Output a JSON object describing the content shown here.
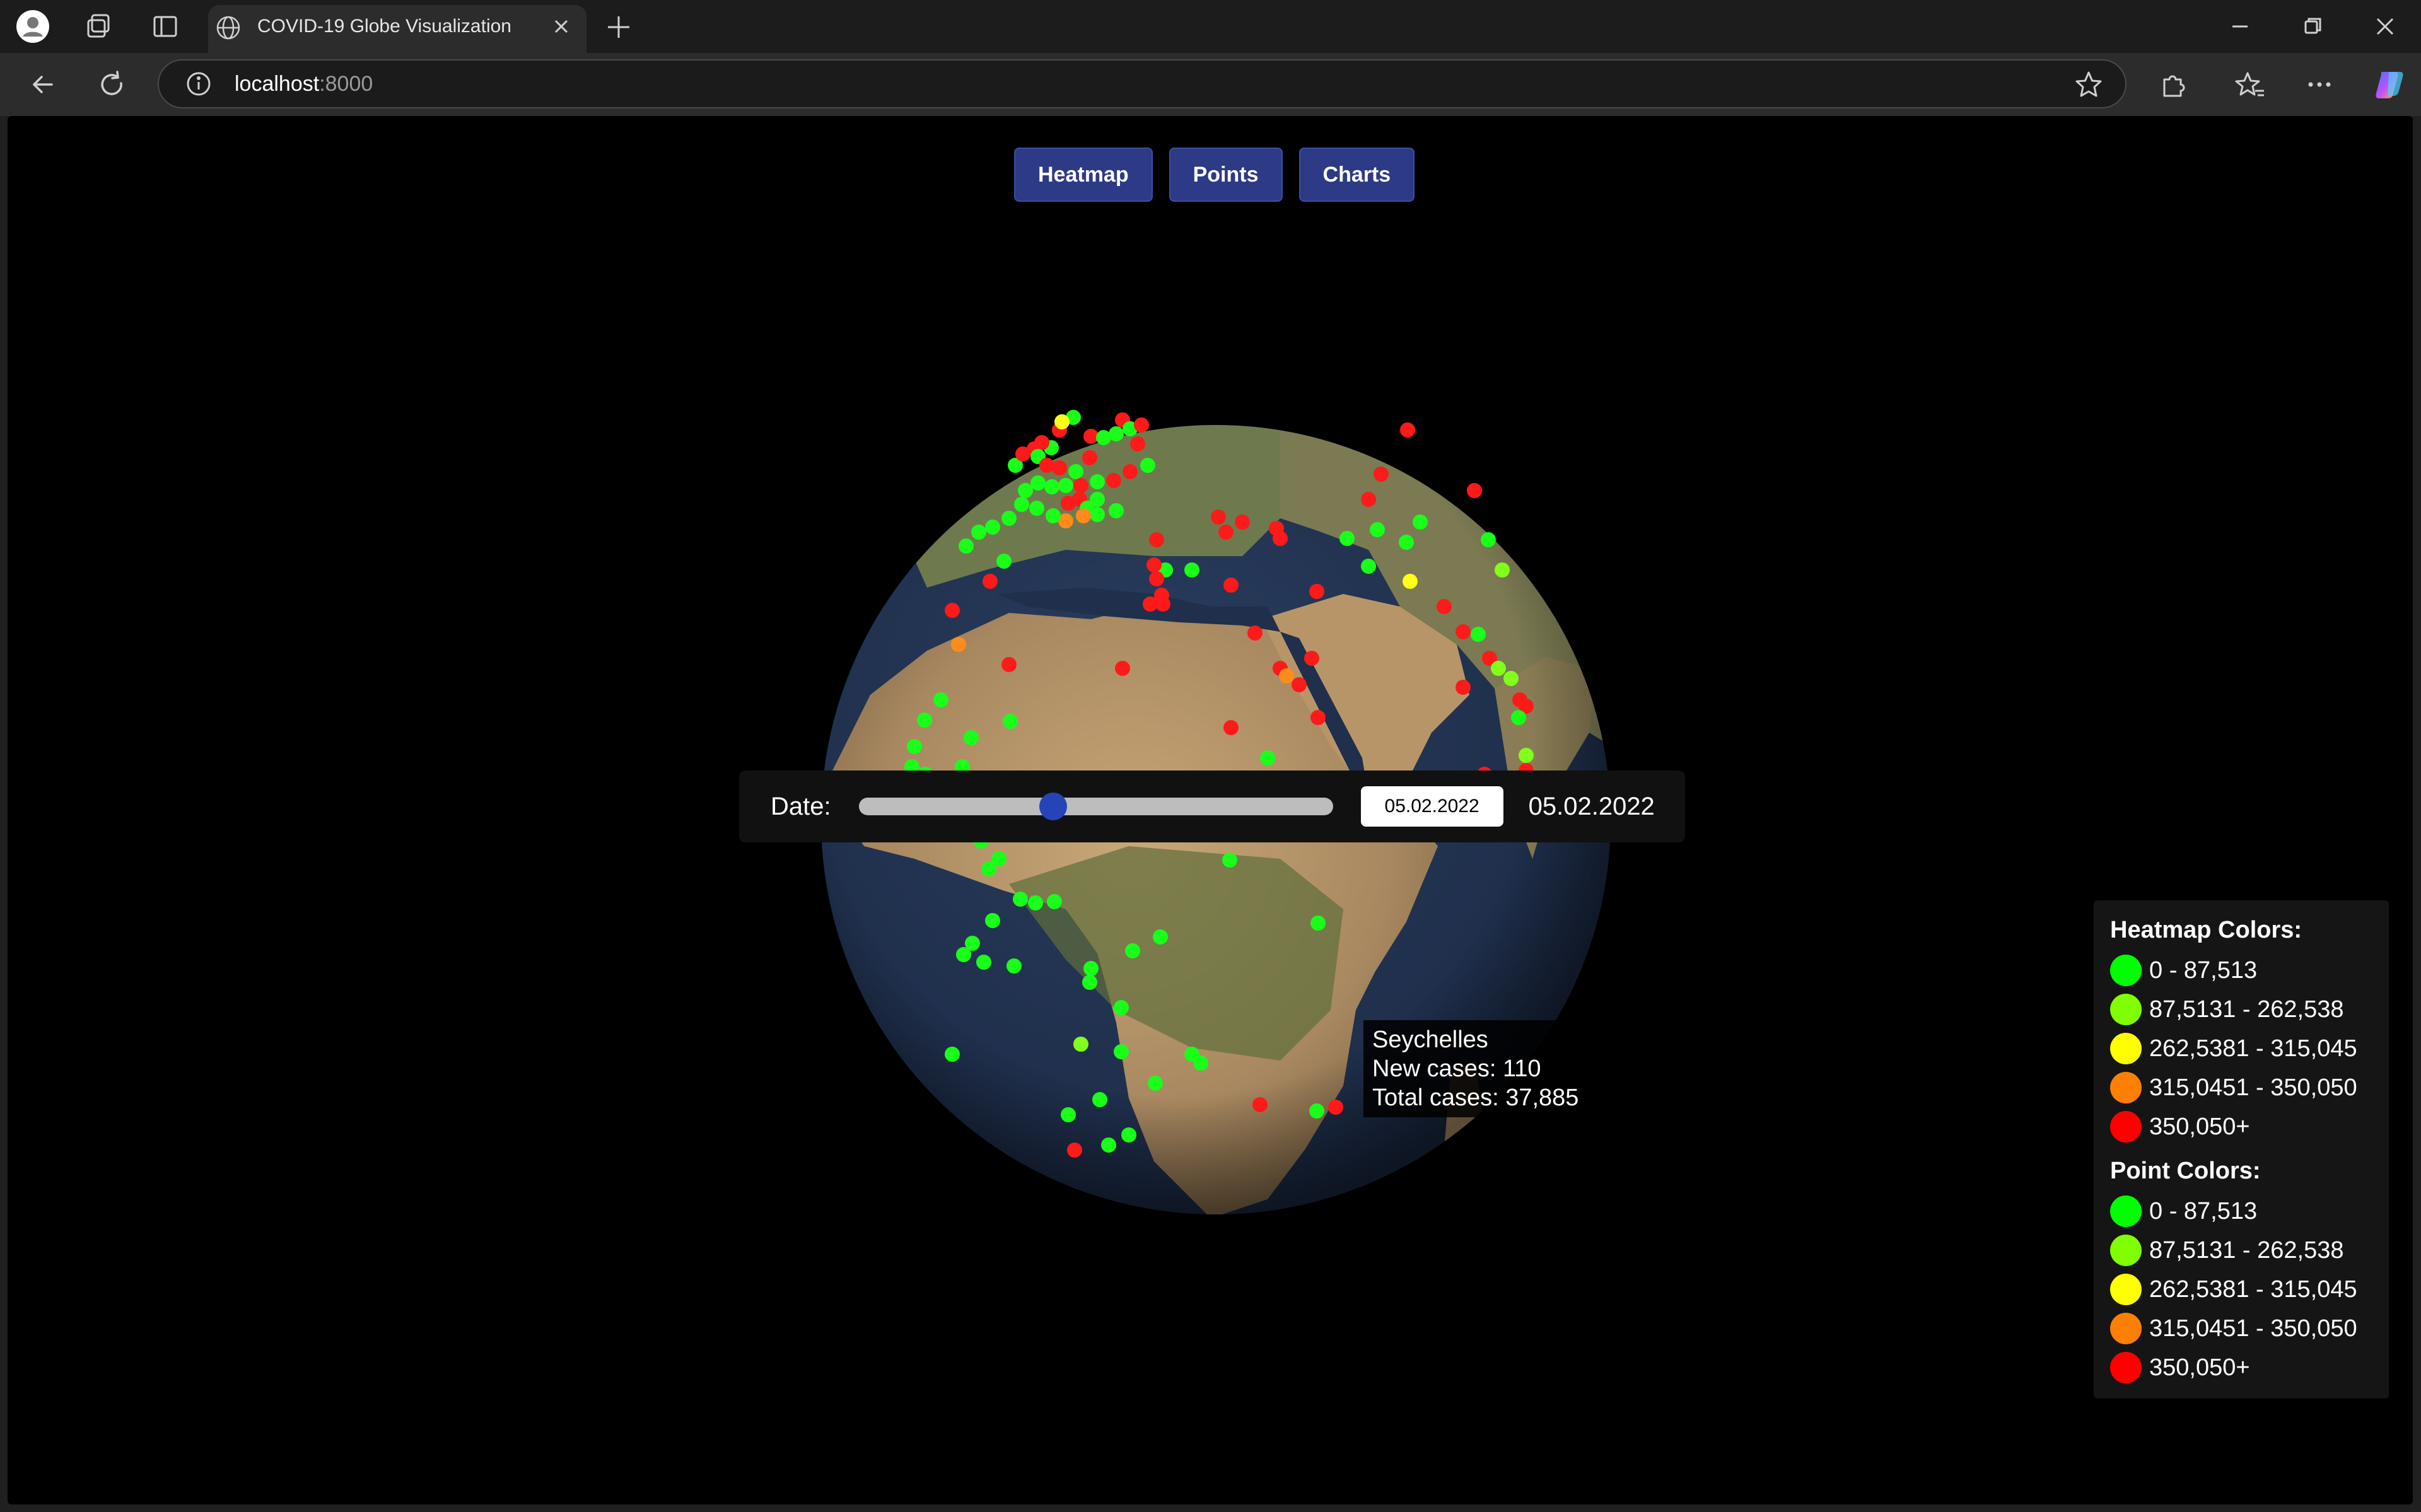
{
  "browser": {
    "tab_title": "COVID-19 Globe Visualization",
    "url_host": "localhost",
    "url_port": ":8000"
  },
  "controls": {
    "heatmap_label": "Heatmap",
    "points_label": "Points",
    "charts_label": "Charts"
  },
  "tooltip": {
    "country": "Seychelles",
    "new_cases": "New cases: 110",
    "total_cases": "Total cases: 37,885"
  },
  "legend": {
    "heatmap_title": "Heatmap Colors:",
    "point_title": "Point Colors:",
    "items": [
      {
        "label": "0 - 87,513",
        "color": "#00ff00"
      },
      {
        "label": "87,5131 - 262,538",
        "color": "#80ff00"
      },
      {
        "label": "262,5381 - 315,045",
        "color": "#ffff00"
      },
      {
        "label": "315,0451 - 350,050",
        "color": "#ff8000"
      },
      {
        "label": "350,050+",
        "color": "#ff0000"
      }
    ]
  },
  "date_control": {
    "label": "Date:",
    "slider_value": 0.41,
    "input_value": "05.02.2022",
    "display_value": "05.02.2022"
  },
  "colors": {
    "button_bg": "#2d3a86",
    "slider_thumb": "#2544b7"
  },
  "icons": {
    "profile": "profile-icon",
    "workspaces": "workspaces-icon",
    "tab_actions": "tab-actions-icon",
    "globe": "globe-icon",
    "info": "info-icon",
    "favorite": "star-icon",
    "extensions": "puzzle-icon",
    "favorites": "favorites-icon",
    "more": "more-icon",
    "copilot": "copilot-icon"
  }
}
